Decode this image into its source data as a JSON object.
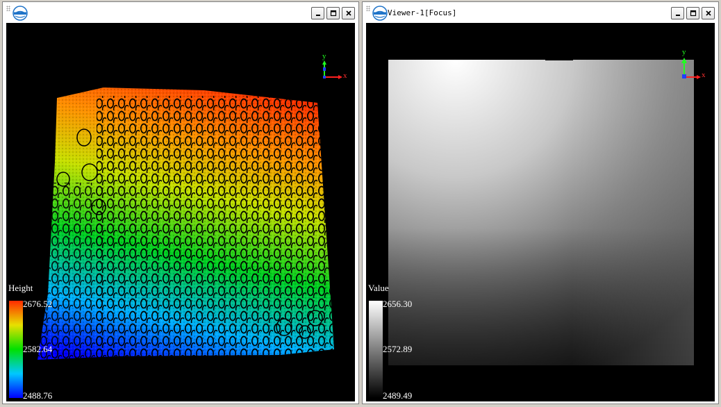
{
  "colors": {
    "frame": "#d4d0c8",
    "viewport_background": "#000000",
    "height_ramp": [
      "#0000ff",
      "#00c8ff",
      "#00e000",
      "#e8e000",
      "#ff2a00"
    ],
    "value_ramp": [
      "#000000",
      "#ffffff"
    ],
    "axis_x": "#ff2020",
    "axis_y": "#20ff20",
    "axis_z": "#2040ff"
  },
  "left_viewer": {
    "title": "",
    "buttons": {
      "minimize": "minimize-icon",
      "maximize": "maximize-icon",
      "close": "close-icon"
    },
    "axis": {
      "x": "x",
      "y": "y"
    },
    "legend": {
      "title": "Height",
      "max": "2676.52",
      "mid": "2582.64",
      "min": "2488.76"
    }
  },
  "right_viewer": {
    "title": "Viewer-1[Focus]",
    "buttons": {
      "minimize": "minimize-icon",
      "maximize": "maximize-icon",
      "close": "close-icon"
    },
    "axis": {
      "x": "x",
      "y": "y"
    },
    "legend": {
      "title": "Value",
      "max": "2656.30",
      "mid": "2572.89",
      "min": "2489.49"
    }
  }
}
